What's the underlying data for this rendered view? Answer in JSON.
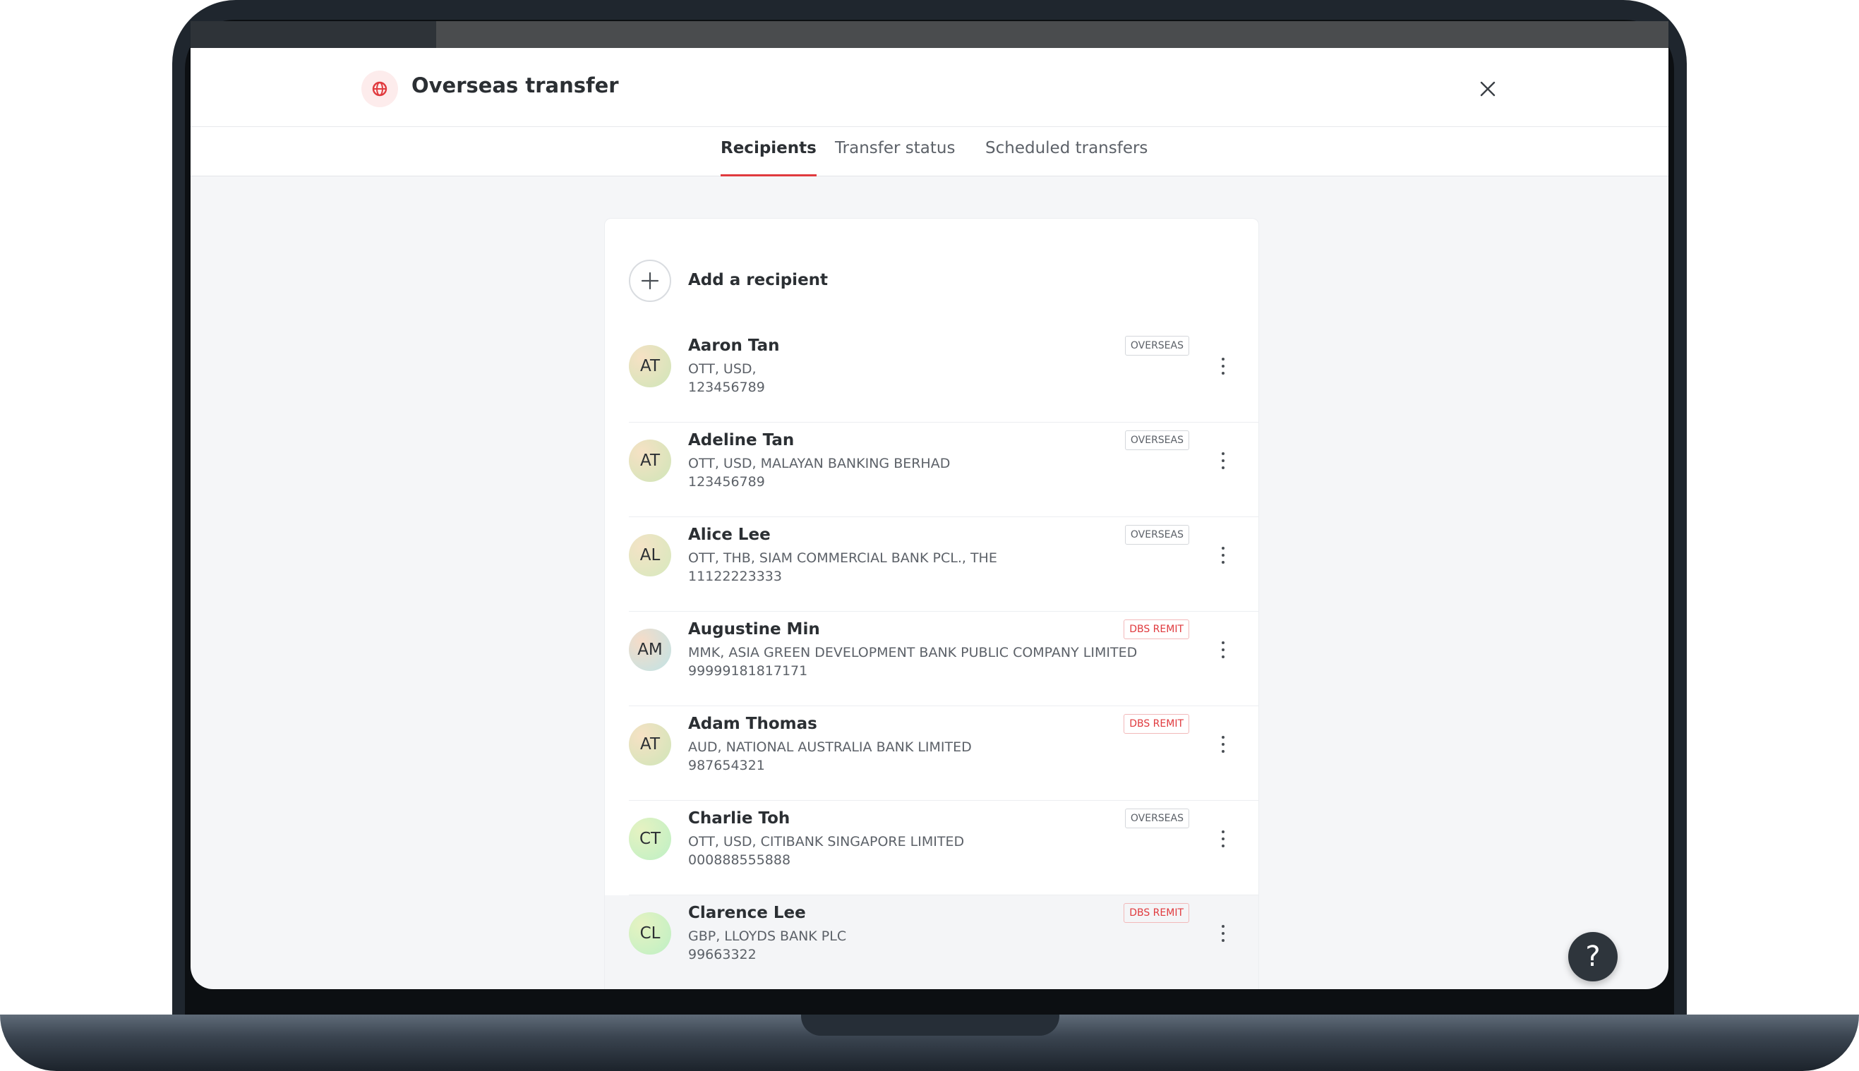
{
  "modal": {
    "title": "Overseas transfer",
    "icon": "globe-icon",
    "close_icon": "close-icon"
  },
  "colors": {
    "accent": "#e03a3e",
    "text_primary": "#2b2f33",
    "text_secondary": "#5c6168"
  },
  "tabs": [
    {
      "label": "Recipients",
      "active": true
    },
    {
      "label": "Transfer status",
      "active": false
    },
    {
      "label": "Scheduled transfers",
      "active": false
    }
  ],
  "add_recipient": {
    "label": "Add a recipient",
    "icon": "plus-icon"
  },
  "recipients": [
    {
      "initials": "AT",
      "name": "Aaron Tan",
      "line1": "OTT, USD,",
      "line2": "123456789",
      "badge": "OVERSEAS",
      "badge_type": "overseas"
    },
    {
      "initials": "AT",
      "name": "Adeline Tan",
      "line1": "OTT, USD, MALAYAN BANKING BERHAD",
      "line2": "123456789",
      "badge": "OVERSEAS",
      "badge_type": "overseas"
    },
    {
      "initials": "AL",
      "name": "Alice Lee",
      "line1": "OTT, THB, SIAM COMMERCIAL BANK PCL., THE",
      "line2": "11122223333",
      "badge": "OVERSEAS",
      "badge_type": "overseas"
    },
    {
      "initials": "AM",
      "name": "Augustine Min",
      "line1": "MMK, ASIA GREEN DEVELOPMENT BANK PUBLIC COMPANY LIMITED",
      "line2": "99999181817171",
      "badge": "DBS REMIT",
      "badge_type": "remit"
    },
    {
      "initials": "AT",
      "name": "Adam Thomas",
      "line1": "AUD, NATIONAL AUSTRALIA BANK LIMITED",
      "line2": "987654321",
      "badge": "DBS REMIT",
      "badge_type": "remit"
    },
    {
      "initials": "CT",
      "name": "Charlie Toh",
      "line1": "OTT, USD, CITIBANK SINGAPORE LIMITED",
      "line2": "000888555888",
      "badge": "OVERSEAS",
      "badge_type": "overseas"
    },
    {
      "initials": "CL",
      "name": "Clarence Lee",
      "line1": "GBP, LLOYDS BANK PLC",
      "line2": "99663322",
      "badge": "DBS REMIT",
      "badge_type": "remit"
    }
  ],
  "help": {
    "label": "?",
    "icon": "help-icon"
  }
}
